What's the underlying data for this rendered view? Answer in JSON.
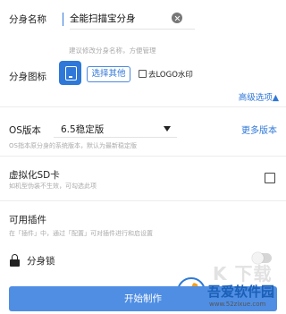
{
  "clone_name": {
    "label": "分身名称",
    "value": "全能扫描宝分身",
    "hint": "建议修改分身名称，方便管理"
  },
  "clone_icon": {
    "label": "分身图标",
    "choose_other": "选择其他",
    "remove_logo": "去LOGO水印",
    "remove_logo_checked": false
  },
  "advanced_options": "高级选项▲",
  "os_version": {
    "label": "OS版本",
    "value": "6.5稳定版",
    "more": "更多版本",
    "hint": "OS指本原分身的系统版本，默认为最新稳定版"
  },
  "virtual_sd": {
    "label": "虚拟化SD卡",
    "hint": "如机型伪装不生效，可勾选此项",
    "checked": false
  },
  "plugins": {
    "label": "可用插件",
    "hint": "在「插件」中，通过「配置」可对插件进行和启设置"
  },
  "clone_lock": {
    "label": "分身锁",
    "enabled": false
  },
  "start_button": "开始制作",
  "watermark": {
    "ghost": "K 下载",
    "brand": "吾爱软件园",
    "url": "www.52zixue.com"
  },
  "colors": {
    "accent": "#2f77d8",
    "button": "#4f8ee3",
    "hint": "#aaaaaa"
  }
}
